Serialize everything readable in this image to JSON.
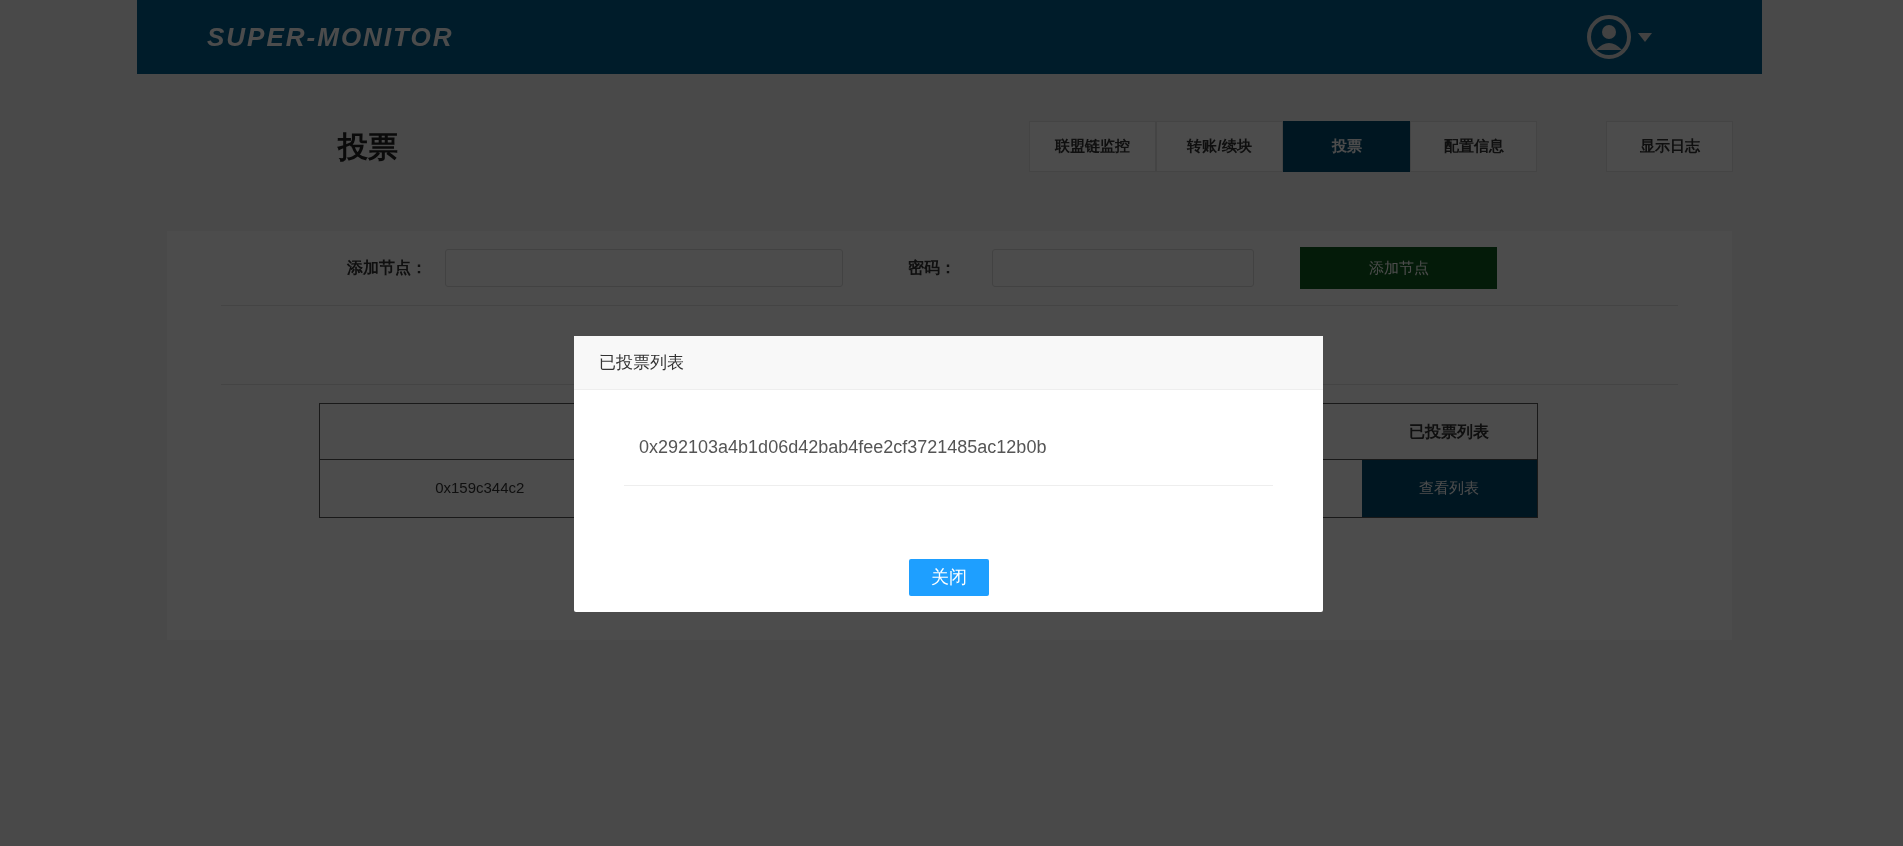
{
  "header": {
    "logo": "SUPER-MONITOR"
  },
  "page_title": "投票",
  "tabs": [
    {
      "label": "联盟链监控",
      "selected": false
    },
    {
      "label": "转账/续块",
      "selected": false
    },
    {
      "label": "投票",
      "selected": true
    },
    {
      "label": "配置信息",
      "selected": false
    }
  ],
  "log_button": "显示日志",
  "form": {
    "node_label": "添加节点：",
    "password_label": "密码：",
    "add_button": "添加节点"
  },
  "table": {
    "columns": [
      "",
      "已投票列表"
    ],
    "rows": [
      {
        "address": "0x159c344c2",
        "action": "查看列表"
      }
    ]
  },
  "modal": {
    "title": "已投票列表",
    "items": [
      "0x292103a4b1d06d42bab4fee2cf3721485ac12b0b"
    ],
    "close_button": "关闭"
  }
}
